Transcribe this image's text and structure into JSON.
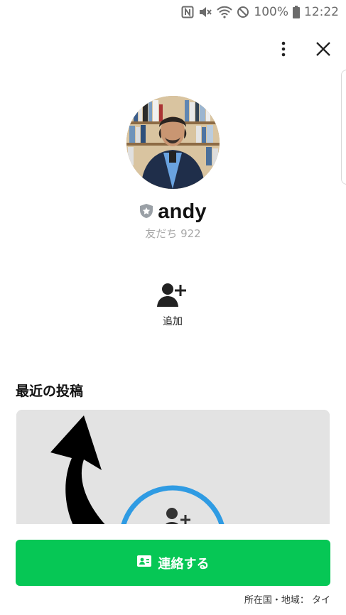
{
  "status_bar": {
    "battery": "100%",
    "time": "12:22"
  },
  "profile": {
    "name": "andy",
    "friends_count": "友だち 922"
  },
  "actions": {
    "add_label": "追加"
  },
  "recent_posts": {
    "title": "最近の投稿"
  },
  "contact_button": {
    "label": "連絡する"
  },
  "region": {
    "text": "所在国・地域： タイ"
  },
  "colors": {
    "accent": "#06c755",
    "post_card_bg": "#e3e3e3",
    "ring": "#2f9be3"
  },
  "icons": [
    "nfc-icon",
    "mute-icon",
    "wifi-icon",
    "no-disturb-icon",
    "battery-icon",
    "more-vert-icon",
    "close-icon",
    "shield-star-icon",
    "add-friend-icon",
    "contact-card-icon"
  ]
}
